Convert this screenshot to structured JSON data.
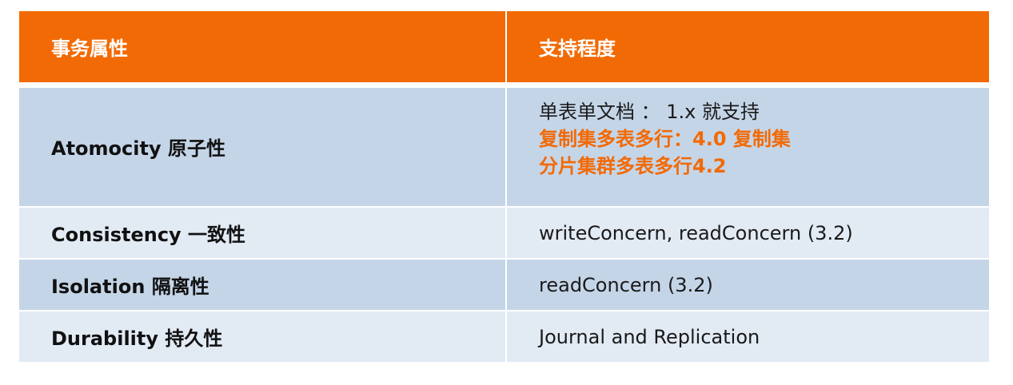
{
  "colors": {
    "header_bg": "#f26a05",
    "row_dark": "#c5d5e8",
    "row_light": "#e2eaf4",
    "accent_text": "#f26a05"
  },
  "header": {
    "col1": "事务属性",
    "col2": "支持程度"
  },
  "rows": [
    {
      "property": "Atomocity 原子性",
      "support": [
        "单表单文档 ： 1.x 就支持",
        "复制集多表多行：4.0 复制集",
        "分片集群多表多行4.2"
      ]
    },
    {
      "property": "Consistency 一致性",
      "support": [
        "writeConcern, readConcern (3.2)"
      ]
    },
    {
      "property": "Isolation 隔离性",
      "support": [
        "readConcern (3.2)"
      ]
    },
    {
      "property": "Durability 持久性",
      "support": [
        "Journal and Replication"
      ]
    }
  ]
}
